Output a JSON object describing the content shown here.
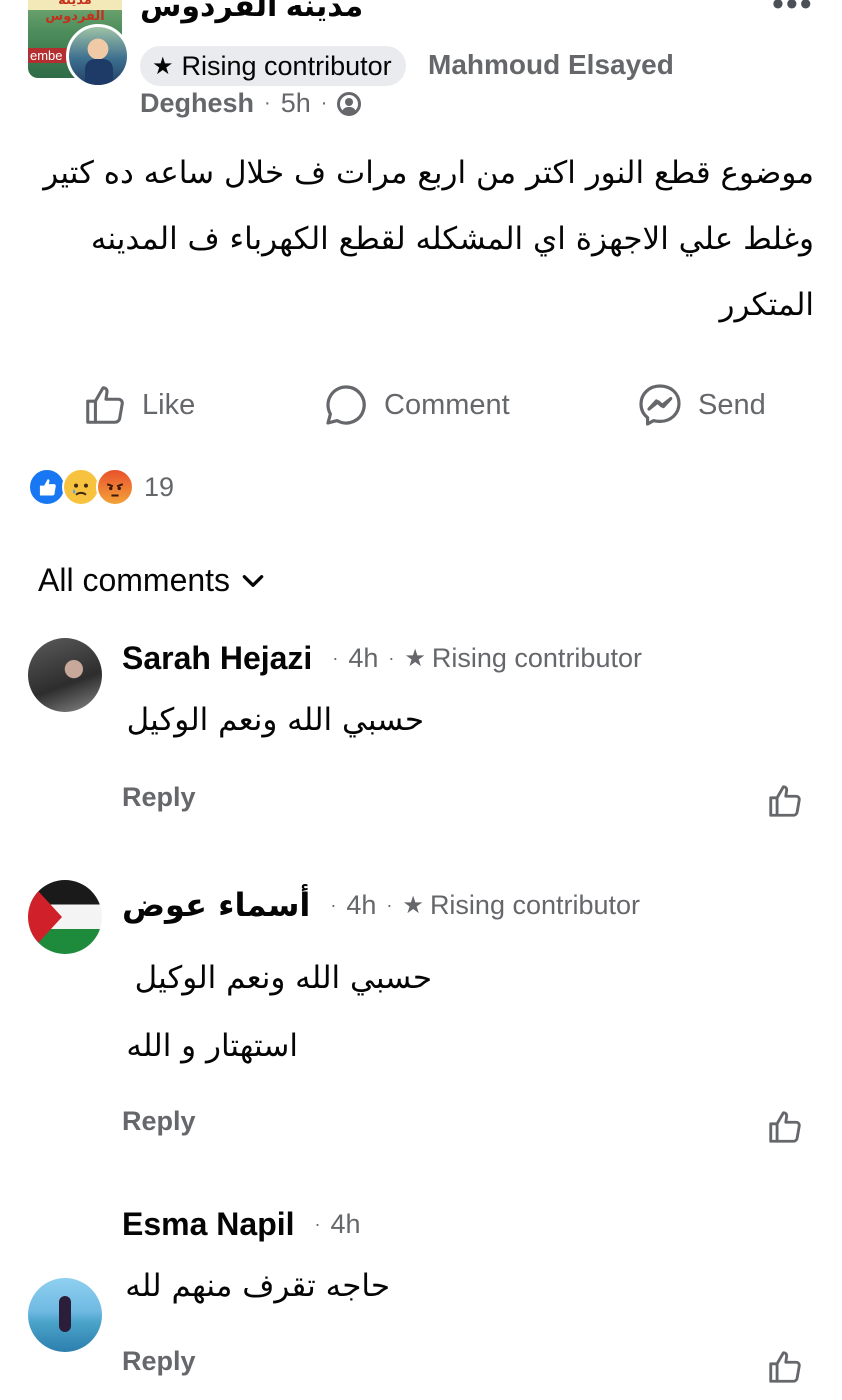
{
  "post": {
    "group_name": "مدينه الفردوس",
    "group_image_text": "مدينة الفردوس",
    "group_image_stamp": "embe",
    "more_icon": "more-dots-icon",
    "badge": "Rising contributor",
    "author_first": "Mahmoud Elsayed",
    "author_last": "Deghesh",
    "time": "5h",
    "privacy_icon": "public-globe-icon",
    "text": "موضوع قطع النور اكتر من اربع مرات ف خلال ساعه ده كتير وغلط علي الاجهزة اي المشكله لقطع الكهرباء ف المدينه المتكرر"
  },
  "actions": {
    "like": "Like",
    "comment": "Comment",
    "send": "Send"
  },
  "reactions": {
    "icons": [
      "like-reaction-icon",
      "sad-reaction-icon",
      "angry-reaction-icon"
    ],
    "count": "19"
  },
  "comments_header": {
    "label": "All comments"
  },
  "comments": [
    {
      "name": "Sarah Hejazi",
      "time": "4h",
      "badge": "Rising contributor",
      "lines": [
        "حسبي الله ونعم الوكيل"
      ],
      "reply": "Reply"
    },
    {
      "name": "أسماء عوض",
      "time": "4h",
      "badge": "Rising contributor",
      "lines": [
        "حسبي الله ونعم الوكيل",
        "استهتار و الله"
      ],
      "reply": "Reply"
    },
    {
      "name": "Esma Napil",
      "time": "4h",
      "lines": [
        "حاجه تقرف منهم لله"
      ],
      "reply": "Reply"
    }
  ],
  "colors": {
    "text": "#050505",
    "muted": "#65676b",
    "badge_bg": "#e9ebee",
    "like_blue": "#1877f2"
  }
}
